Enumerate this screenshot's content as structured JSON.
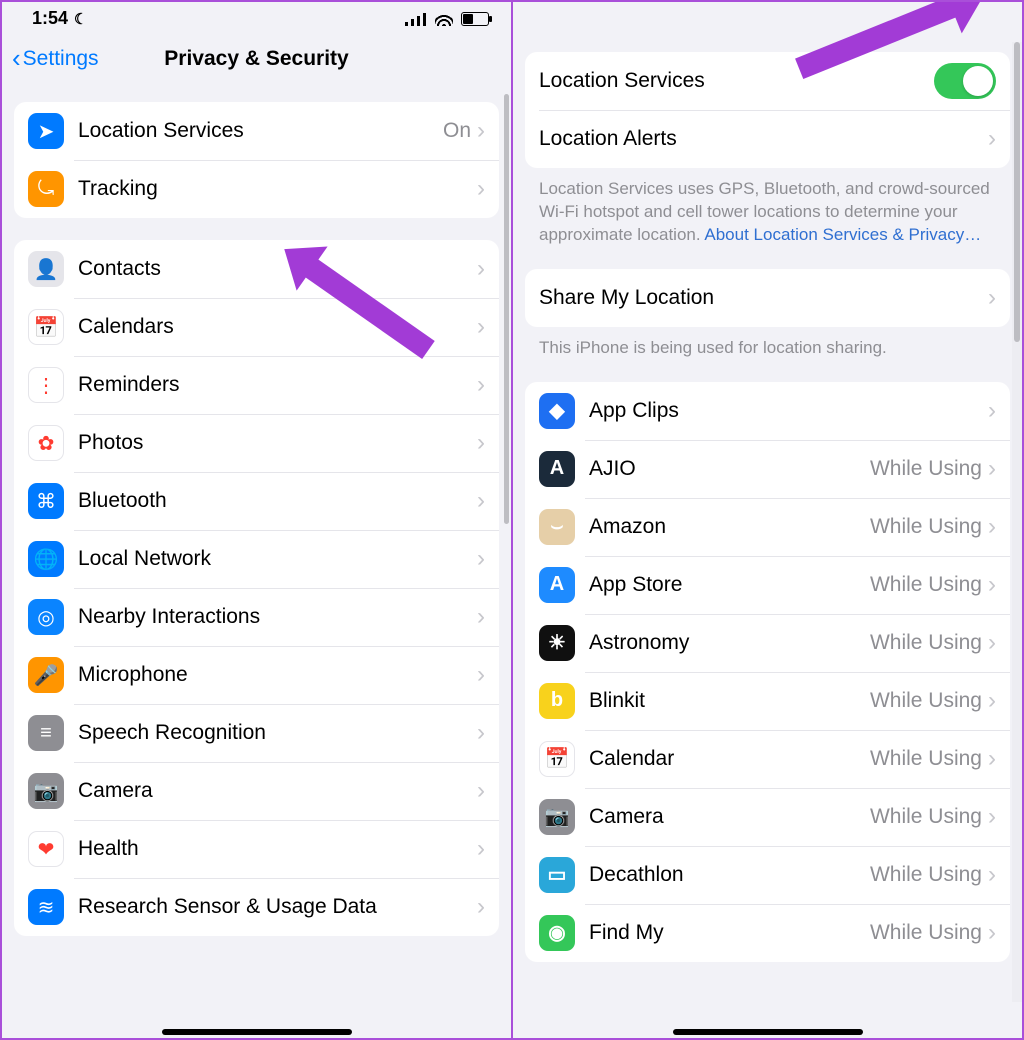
{
  "left": {
    "status": {
      "time": "1:54"
    },
    "nav": {
      "back": "Settings",
      "title": "Privacy & Security"
    },
    "group1": [
      {
        "name": "location-services",
        "icon_bg": "#007aff",
        "glyph": "➤",
        "label": "Location Services",
        "value": "On"
      },
      {
        "name": "tracking",
        "icon_bg": "#ff9500",
        "glyph": "⤿",
        "label": "Tracking",
        "value": ""
      }
    ],
    "group2": [
      {
        "name": "contacts",
        "icon_bg": "#e5e5ea",
        "glyph": "👤",
        "label": "Contacts"
      },
      {
        "name": "calendars",
        "icon_bg": "#ffffff",
        "glyph": "📅",
        "label": "Calendars"
      },
      {
        "name": "reminders",
        "icon_bg": "#ffffff",
        "glyph": "⋮",
        "label": "Reminders"
      },
      {
        "name": "photos",
        "icon_bg": "#ffffff",
        "glyph": "✿",
        "label": "Photos"
      },
      {
        "name": "bluetooth",
        "icon_bg": "#007aff",
        "glyph": "⌘",
        "label": "Bluetooth"
      },
      {
        "name": "local-network",
        "icon_bg": "#007aff",
        "glyph": "🌐",
        "label": "Local Network"
      },
      {
        "name": "nearby-interactions",
        "icon_bg": "#0a84ff",
        "glyph": "◎",
        "label": "Nearby Interactions"
      },
      {
        "name": "microphone",
        "icon_bg": "#ff9500",
        "glyph": "🎤",
        "label": "Microphone"
      },
      {
        "name": "speech-recognition",
        "icon_bg": "#8e8e93",
        "glyph": "≡",
        "label": "Speech Recognition"
      },
      {
        "name": "camera",
        "icon_bg": "#8e8e93",
        "glyph": "📷",
        "label": "Camera"
      },
      {
        "name": "health",
        "icon_bg": "#ffffff",
        "glyph": "❤",
        "label": "Health"
      },
      {
        "name": "research",
        "icon_bg": "#007aff",
        "glyph": "≋",
        "label": "Research Sensor & Usage Data"
      }
    ]
  },
  "right": {
    "toggle_row": {
      "label": "Location Services",
      "on": true
    },
    "alerts_row": {
      "label": "Location Alerts"
    },
    "desc": "Location Services uses GPS, Bluetooth, and crowd-sourced Wi-Fi hotspot and cell tower locations to determine your approximate location. ",
    "desc_link": "About Location Services & Privacy…",
    "share_row": {
      "label": "Share My Location"
    },
    "share_desc": "This iPhone is being used for location sharing.",
    "apps": [
      {
        "name": "app-clips",
        "icon_bg": "#1e6ff2",
        "glyph": "◆",
        "label": "App Clips",
        "value": ""
      },
      {
        "name": "ajio",
        "icon_bg": "#1b2a3a",
        "glyph": "A",
        "label": "AJIO",
        "value": "While Using"
      },
      {
        "name": "amazon",
        "icon_bg": "#e6cfa8",
        "glyph": "⌣",
        "label": "Amazon",
        "value": "While Using"
      },
      {
        "name": "app-store",
        "icon_bg": "#1e8bff",
        "glyph": "A",
        "label": "App Store",
        "value": "While Using"
      },
      {
        "name": "astronomy",
        "icon_bg": "#101010",
        "glyph": "☀",
        "label": "Astronomy",
        "value": "While Using"
      },
      {
        "name": "blinkit",
        "icon_bg": "#f8d21c",
        "glyph": "b",
        "label": "Blinkit",
        "value": "While Using"
      },
      {
        "name": "calendar",
        "icon_bg": "#ffffff",
        "glyph": "📅",
        "label": "Calendar",
        "value": "While Using"
      },
      {
        "name": "camera-app",
        "icon_bg": "#8e8e93",
        "glyph": "📷",
        "label": "Camera",
        "value": "While Using"
      },
      {
        "name": "decathlon",
        "icon_bg": "#2aa7d9",
        "glyph": "▭",
        "label": "Decathlon",
        "value": "While Using"
      },
      {
        "name": "find-my",
        "icon_bg": "#34c759",
        "glyph": "◉",
        "label": "Find My",
        "value": "While Using"
      }
    ]
  }
}
